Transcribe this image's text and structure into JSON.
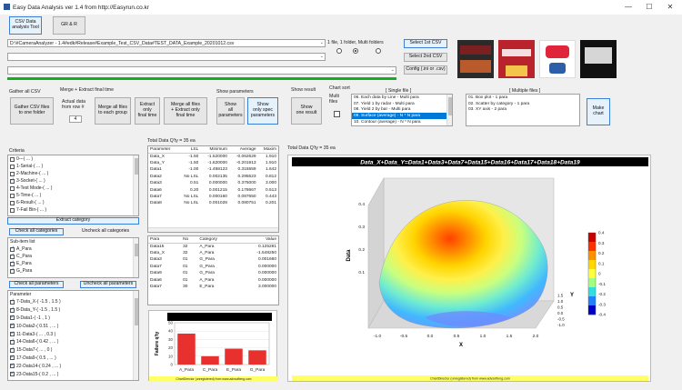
{
  "window": {
    "title": "Easy Data Analysis ver 1.4 from http://Easyrun.co.kr",
    "min_label": "—",
    "max_label": "☐",
    "close_label": "✕"
  },
  "toolbar": {
    "csv_data_tool": "CSV Data\nanalysis Tool",
    "grr": "GR & R"
  },
  "file": {
    "path": "D:\\#CameraAnalyzer - 1.4#edk#Release#Example_Test_CSV_Data#TEST_DATA_Example_20201012.csv",
    "second_path": "",
    "third_path": "",
    "mode_label": "1 file, 1 folder, Multi folders",
    "select_1st": "Select 1st CSV",
    "select_2nd": "Select 2nd CSV",
    "config": "Config (.ini or .csv)"
  },
  "books": [
    "Imaging Application",
    "Chinese Language",
    "Tech Book",
    "Chinese Characters"
  ],
  "gather": {
    "title": "Gather all CSV",
    "button": "Gather CSV files\nto one folder"
  },
  "merge": {
    "title": "Merge + Extract final time",
    "actual_data_label": "Actual data\nfrom row #",
    "row_value": "4",
    "merge_all": "Merge all files\nto each group",
    "extract_final": "Extract\nonly\nfinal time",
    "merge_extract": "Merge all files\n+ Extract only\nfinal time"
  },
  "show_params": {
    "title": "Show parameters",
    "show_all": "Show\nall\nparameters",
    "show_spec": "Show\nonly spec\nparameters"
  },
  "show_result": {
    "title": "Show result",
    "button": "Show\none result"
  },
  "chart_sort": {
    "title": "Chart sort",
    "multi_files": "Multi\nfiles",
    "single_header": "[ Single file ]",
    "multiple_header": "[ Multiple files ]",
    "single_items": [
      "06. Each data by Line - Multi para",
      "07. Yield 1 by radar - Multi para",
      "08. Yield 2 by bar - Multi para",
      "09. Surface (average) - N * N para",
      "10. Contour (average) - N * N para"
    ],
    "selected_single": 3,
    "multiple_items": [
      "01. Box plot - 1 para",
      "02. Scatter by category - 1 para",
      "03. XY axis - 2 para"
    ],
    "make_chart": "Make\nchart"
  },
  "criteria": {
    "title": "Criteria",
    "items": [
      "0---( ... )",
      "1-Serial-( ... )",
      "2-Machine-( ... )",
      "3-Socket-( ... )",
      "4-Test Mode-( ... )",
      "5-Time-( ... )",
      "6-Result-( ... )",
      "7-Fail Bin-( ... )"
    ],
    "checked": [
      false,
      false,
      false,
      true,
      false,
      false,
      false,
      false
    ],
    "extract_button": "Extract category"
  },
  "categories": {
    "check_all": "Check all categories",
    "uncheck_all": "Uncheck all categories",
    "sub_item_label": "Sub-item list",
    "items": [
      "A_Para",
      "C_Para",
      "E_Para",
      "G_Para"
    ],
    "checked": [
      true,
      true,
      true,
      true
    ]
  },
  "params": {
    "check_all": "Check all parameters",
    "uncheck_all": "Uncheck all parameters",
    "list_label": "Parameter",
    "items": [
      "7-Data_X-( -1.5 , 1.5 )",
      "8-Data_Y-( -1.5 , 1.5 )",
      "9-Data1-( -1 , 1 )",
      "10-Data2-( 0.51 , ... )",
      "11-Data3-( ... , 0.3 )",
      "14-Data6-( 0.42 , ... )",
      "15-Data7-( ... , 0 )",
      "17-Data9-( 0.5 , ... )",
      "22-Data14-( 0.24 , ... )",
      "23-Data15-( 0.2 , ... )"
    ],
    "checked": [
      true,
      true,
      true,
      true,
      true,
      true,
      true,
      true,
      true,
      true
    ]
  },
  "total_qty": "Total Data Q'ty = 35 ea",
  "stats_table": {
    "headers": [
      "Parameter",
      "LSL",
      "Minimum",
      "Average",
      "Maxim"
    ],
    "rows": [
      [
        "Data_X",
        "-1.50",
        "-1.520000",
        "-0.062629",
        "1.910"
      ],
      [
        "Data_Y",
        "-1.50",
        "-1.620000",
        "-0.201913",
        "1.910"
      ],
      [
        "Data1",
        "-1.00",
        "-1.458123",
        "0.315559",
        "1.642"
      ],
      [
        "Data2",
        "No LSL",
        "0.002135",
        "0.295523",
        "0.812"
      ],
      [
        "Data3",
        "0.51",
        "0.000000",
        "0.375000",
        "3.000"
      ],
      [
        "Data6",
        "0.20",
        "0.001215",
        "0.178667",
        "0.513"
      ],
      [
        "Data7",
        "No LSL",
        "0.000160",
        "0.087650",
        "0.443"
      ],
      [
        "Data8",
        "No LSL",
        "0.001028",
        "0.080751",
        "0.201"
      ]
    ]
  },
  "fail_table": {
    "headers": [
      "Para",
      "No",
      "Category",
      "Value"
    ],
    "rows": [
      [
        "Data15",
        "32",
        "A_Para",
        "0.125281"
      ],
      [
        "Data_X",
        "32",
        "A_Para",
        "-1.548250"
      ],
      [
        "Data3",
        "01",
        "G_Para",
        "0.001660"
      ],
      [
        "Data7",
        "01",
        "G_Para",
        "0.000000"
      ],
      [
        "Data9",
        "01",
        "G_Para",
        "0.000000"
      ],
      [
        "Data6",
        "01",
        "A_Para",
        "0.000000"
      ],
      [
        "Data7",
        "30",
        "E_Para",
        "3.000000"
      ]
    ]
  },
  "surface_chart_heading": "Total Data Q'ty = 35 ea",
  "chart_data": [
    {
      "type": "bar",
      "title": "Failures in each Para",
      "ylabel": "Failure q'ty",
      "categories": [
        "A_Para",
        "C_Para",
        "E_Para",
        "G_Para"
      ],
      "values": [
        37,
        10,
        19,
        17
      ],
      "ylim": [
        0,
        50
      ],
      "yticks": [
        0,
        10,
        20,
        30,
        40,
        50
      ],
      "color": "#e8302f",
      "footer": "ChartDirector (unregistered) from www.advsofteng.com"
    },
    {
      "type": "heatmap",
      "title": "Data_X+Data_Y=Data1+Data3+Data7+Data15+Data16+Data17+Data18+Data19",
      "xlabel": "X",
      "ylabel": "Y",
      "zlabel": "Data",
      "xticks": [
        "-1.0",
        "-0.5",
        "0.0",
        "0.5",
        "1.0",
        "1.5",
        "2.0"
      ],
      "yticks": [
        "-1.0",
        "-0.5",
        "0.0",
        "0.5",
        "1.0",
        "1.5"
      ],
      "zticks": [
        "0.1",
        "0.2",
        "0.3",
        "0.4"
      ],
      "colorbar": [
        "0.4",
        "0.3",
        "0.2",
        "0.1",
        "0",
        "-0.1",
        "-0.2",
        "-0.3",
        "-0.4"
      ],
      "colorbar_colors": [
        "#c80000",
        "#ff3000",
        "#ff9000",
        "#ffd800",
        "#ffff40",
        "#a0ff80",
        "#30e0e0",
        "#2080ff",
        "#0000c8"
      ],
      "footer": "ChartDirector (unregistered) from www.advsofteng.com"
    }
  ]
}
